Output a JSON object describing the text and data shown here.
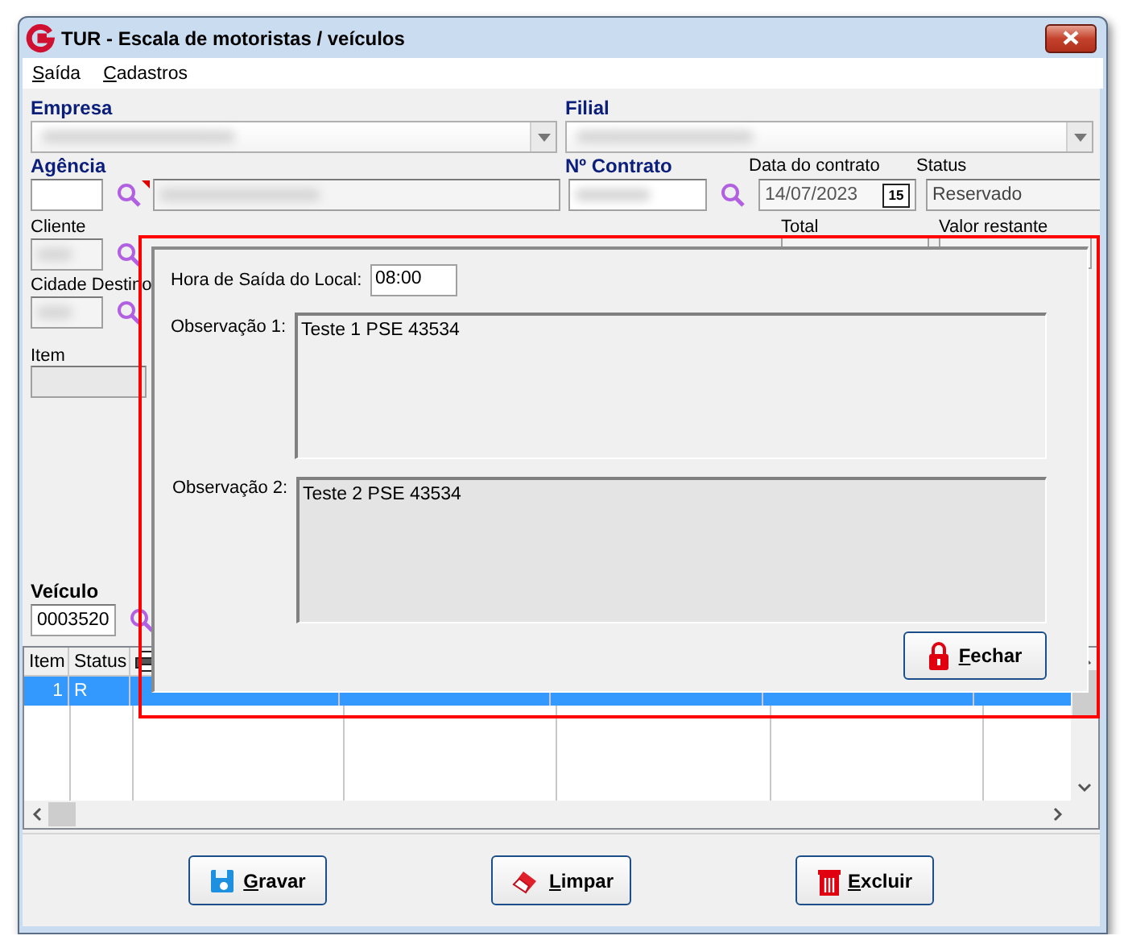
{
  "window": {
    "title": "TUR - Escala de motoristas / veículos"
  },
  "menu": [
    {
      "label": "Saída"
    },
    {
      "label": "Cadastros"
    }
  ],
  "form": {
    "empresa": {
      "label": "Empresa"
    },
    "filial": {
      "label": "Filial"
    },
    "agencia": {
      "label": "Agência"
    },
    "contrato": {
      "label": "Nº Contrato"
    },
    "data_contrato": {
      "label": "Data do contrato",
      "value": "14/07/2023",
      "calendar": "15"
    },
    "status": {
      "label": "Status",
      "value": "Reservado"
    },
    "cliente": {
      "label": "Cliente"
    },
    "cidade_destino": {
      "label": "Cidade Destino"
    },
    "item": {
      "label": "Item"
    },
    "total": {
      "label": "Total"
    },
    "valor_restante": {
      "label": "Valor restante"
    },
    "veiculo": {
      "label": "Veículo",
      "value": "0003520"
    }
  },
  "grid": {
    "columns": [
      "Item",
      "Status"
    ],
    "rows": [
      {
        "selected": true,
        "cells": [
          "1",
          "R"
        ]
      }
    ]
  },
  "buttons": [
    {
      "kind": "save",
      "label": "Gravar"
    },
    {
      "kind": "clear",
      "label": "Limpar"
    },
    {
      "kind": "delete",
      "label": "Excluir"
    }
  ],
  "dialog": {
    "hora_label": "Hora de Saída do Local:",
    "hora_value": "08:00",
    "obs1_label": "Observação 1:",
    "obs1_value": "Teste 1 PSE 43534",
    "obs2_label": "Observação 2:",
    "obs2_value": "Teste 2 PSE 43534",
    "close_button": "Fechar"
  }
}
